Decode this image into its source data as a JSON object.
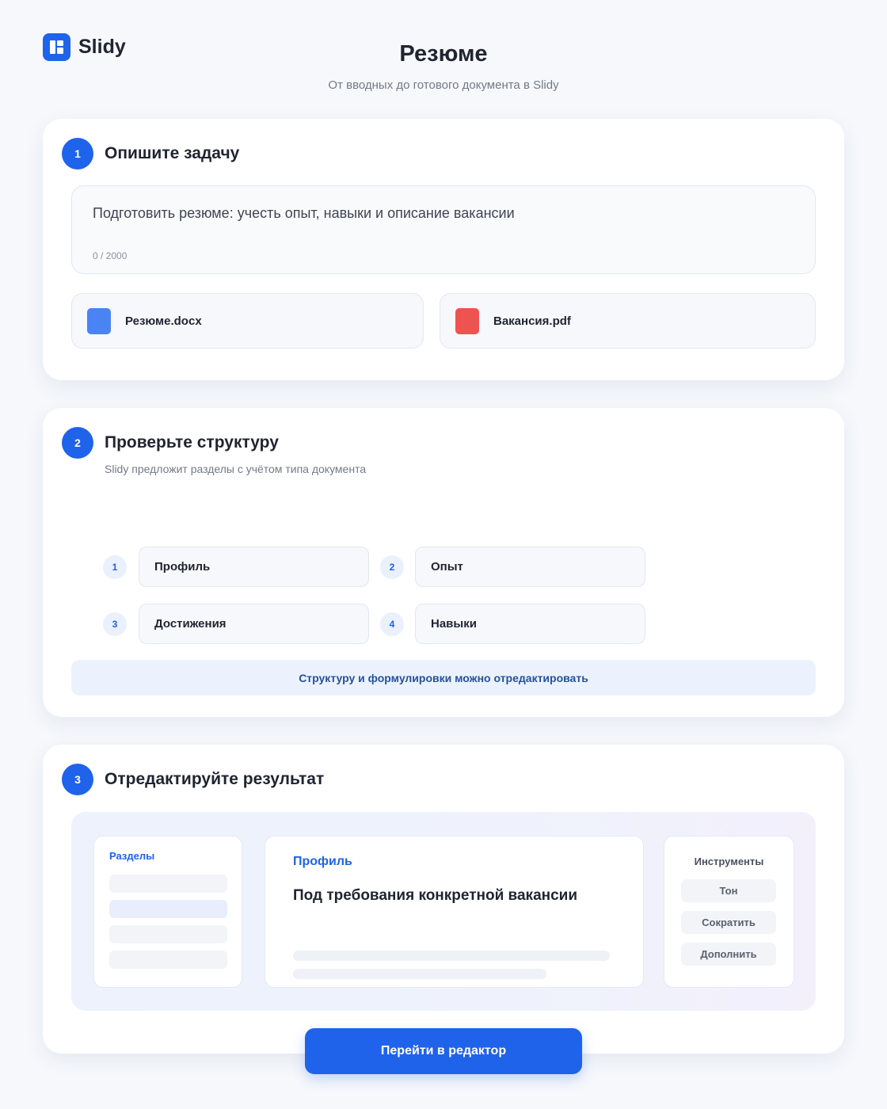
{
  "brand": {
    "name": "Slidy",
    "icon": "slidy-logo-icon",
    "accent": "#1f63ea"
  },
  "header": {
    "title": "Резюме",
    "subtitle": "От вводных до готового документа в Slidy"
  },
  "step1": {
    "number": "1",
    "title": "Опишите задачу",
    "task_text": "Подготовить резюме: учесть опыт, навыки и описание вакансии",
    "char_count": "0 / 2000",
    "files": [
      {
        "name": "Резюме.docx",
        "icon": "docx-file-icon",
        "color": "#4a83f4"
      },
      {
        "name": "Вакансия.pdf",
        "icon": "pdf-file-icon",
        "color": "#ef5350"
      }
    ]
  },
  "step2": {
    "number": "2",
    "title": "Проверьте структуру",
    "description": "Slidy предложит разделы с учётом типа документа",
    "sections": [
      {
        "number": "1",
        "label": "Профиль"
      },
      {
        "number": "2",
        "label": "Опыт"
      },
      {
        "number": "3",
        "label": "Достижения"
      },
      {
        "number": "4",
        "label": "Навыки"
      }
    ],
    "hint": "Структуру и формулировки можно отредактировать"
  },
  "step3": {
    "number": "3",
    "title": "Отредактируйте результат",
    "editor": {
      "sections_title": "Разделы",
      "section_label": "Профиль",
      "heading": "Под требования конкретной вакансии",
      "tools_title": "Инструменты",
      "tools": [
        "Тон",
        "Сократить",
        "Дополнить"
      ]
    }
  },
  "cta": {
    "label": "Перейти в редактор"
  }
}
